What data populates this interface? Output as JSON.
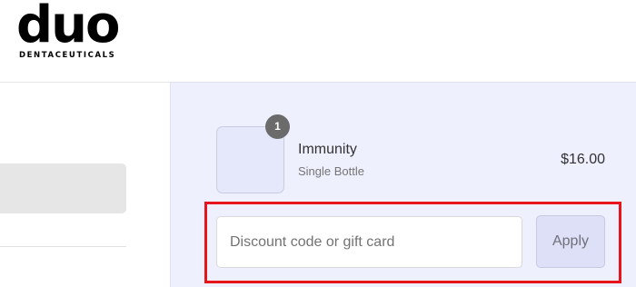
{
  "brand": {
    "logo_word": "duo",
    "logo_sub": "DENTACEUTICALS"
  },
  "order_summary": {
    "product": {
      "quantity": "1",
      "name": "Immunity",
      "variant": "Single Bottle",
      "price": "$16.00"
    },
    "discount": {
      "placeholder": "Discount code or gift card",
      "value": "",
      "apply_label": "Apply"
    }
  },
  "colors": {
    "summary_bg": "#eef0fe",
    "highlight": "#e8141b",
    "badge": "#6b6b6b"
  }
}
